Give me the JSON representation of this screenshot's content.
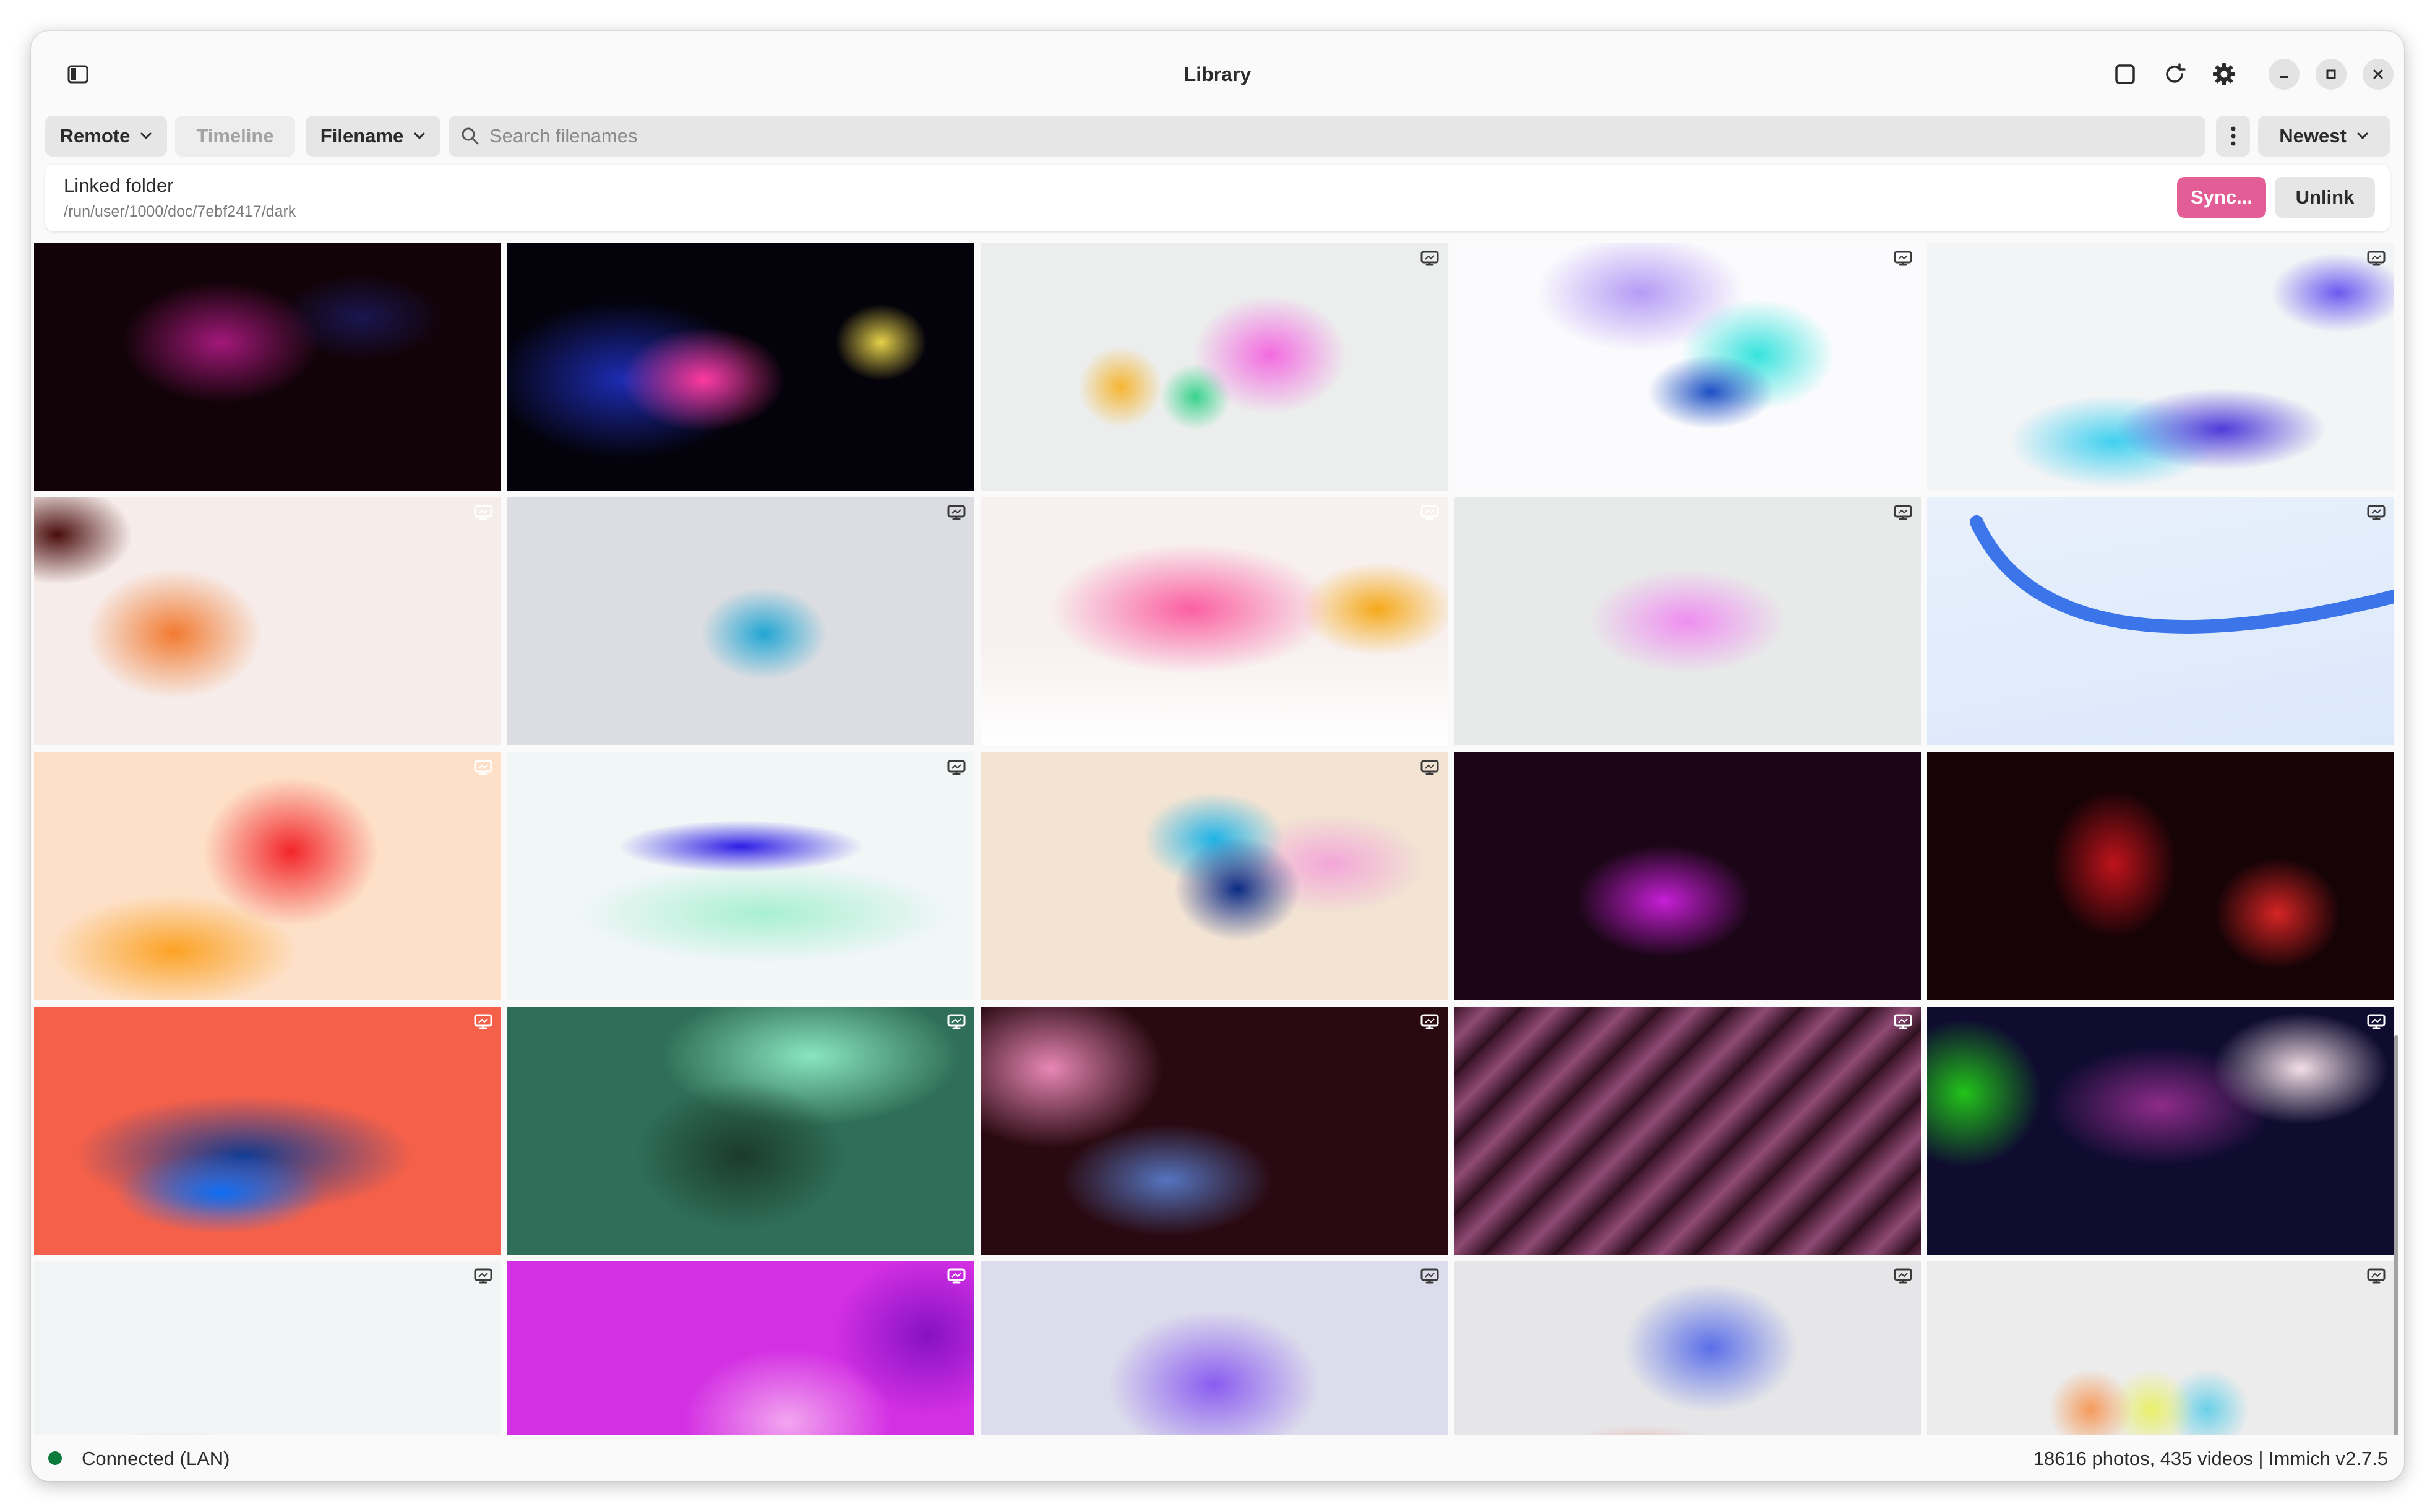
{
  "window": {
    "title": "Library"
  },
  "toolbar": {
    "source_label": "Remote",
    "timeline_label": "Timeline",
    "sort_field_label": "Filename",
    "search_placeholder": "Search filenames",
    "order_label": "Newest"
  },
  "linked_folder": {
    "title": "Linked folder",
    "path": "/run/user/1000/doc/7ebf2417/dark",
    "sync_label": "Sync...",
    "unlink_label": "Unlink"
  },
  "status": {
    "connection": "Connected (LAN)",
    "summary": "18616 photos, 435 videos | Immich v2.7.5"
  },
  "colors": {
    "accent": "#e35d96",
    "connected": "#0b7a3b"
  },
  "thumbnails": [
    {
      "badge": false
    },
    {
      "badge": false
    },
    {
      "badge": true
    },
    {
      "badge": true
    },
    {
      "badge": true
    },
    {
      "badge": true
    },
    {
      "badge": true
    },
    {
      "badge": true
    },
    {
      "badge": true
    },
    {
      "badge": true
    },
    {
      "badge": true
    },
    {
      "badge": true
    },
    {
      "badge": true
    },
    {
      "badge": false
    },
    {
      "badge": false
    },
    {
      "badge": true
    },
    {
      "badge": true
    },
    {
      "badge": true
    },
    {
      "badge": true
    },
    {
      "badge": true
    },
    {
      "badge": true
    },
    {
      "badge": true
    },
    {
      "badge": true
    },
    {
      "badge": true
    },
    {
      "badge": true
    }
  ]
}
